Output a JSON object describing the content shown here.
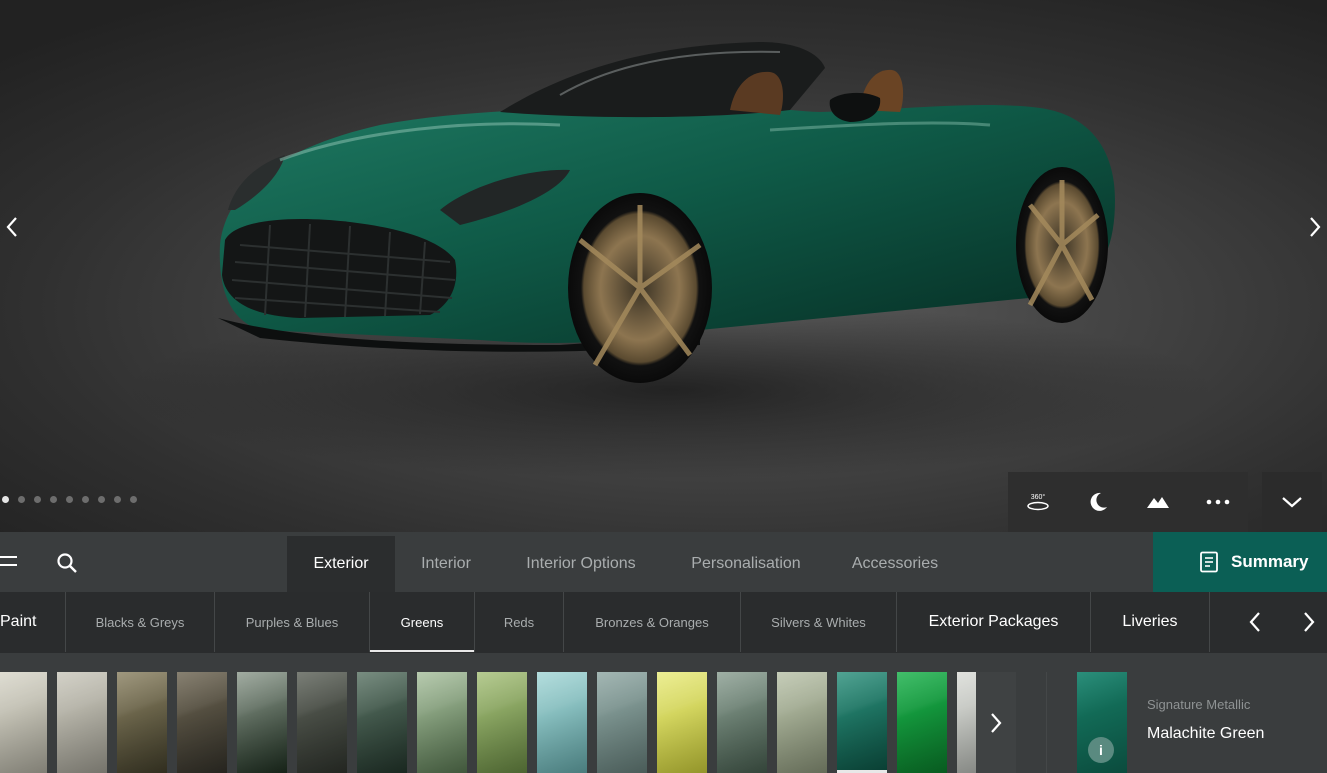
{
  "nav": {
    "tabs": [
      {
        "label": "Exterior"
      },
      {
        "label": "Interior"
      },
      {
        "label": "Interior Options"
      },
      {
        "label": "Personalisation"
      },
      {
        "label": "Accessories"
      }
    ],
    "summary_label": "Summary"
  },
  "categories": [
    "Paint",
    "Blacks & Greys",
    "Purples & Blues",
    "Greens",
    "Reds",
    "Bronzes & Oranges",
    "Silvers & Whites",
    "Exterior Packages",
    "Liveries"
  ],
  "gallery": {
    "dots": 9,
    "active_dot": 0
  },
  "view_controls": [
    "360-icon",
    "night-mode-icon",
    "scene-icon",
    "more-icon",
    "collapse-icon"
  ],
  "swatches": [
    {
      "c1": "#d8d6c9",
      "c2": "#9c9a8e"
    },
    {
      "c1": "#c9c7bb",
      "c2": "#8f8d83"
    },
    {
      "c1": "#8a8162",
      "c2": "#3b3826"
    },
    {
      "c1": "#6d6552",
      "c2": "#2e2c25"
    },
    {
      "c1": "#8d9a8d",
      "c2": "#1b2a1d"
    },
    {
      "c1": "#5d6259",
      "c2": "#2a2e28"
    },
    {
      "c1": "#5b7465",
      "c2": "#1f3027"
    },
    {
      "c1": "#a7bf9d",
      "c2": "#4f6a49"
    },
    {
      "c1": "#a6c07a",
      "c2": "#5d7a3c"
    },
    {
      "c1": "#a3d6d6",
      "c2": "#5a9798"
    },
    {
      "c1": "#8fa7a3",
      "c2": "#5a706c"
    },
    {
      "c1": "#e8ea7c",
      "c2": "#b4b634"
    },
    {
      "c1": "#8a9e91",
      "c2": "#3f5346"
    },
    {
      "c1": "#b9c2a9",
      "c2": "#7a836b"
    },
    {
      "c1": "#2b8f7b",
      "c2": "#0b4b3d"
    },
    {
      "c1": "#19b04a",
      "c2": "#0a6f27"
    },
    {
      "c1": "#d9dbd6",
      "c2": "#a4a7a2"
    }
  ],
  "selected": {
    "index": 14,
    "finish": "Signature Metallic",
    "name": "Malachite Green",
    "info": "i"
  },
  "colors": {
    "accent": "#0b5f55"
  }
}
